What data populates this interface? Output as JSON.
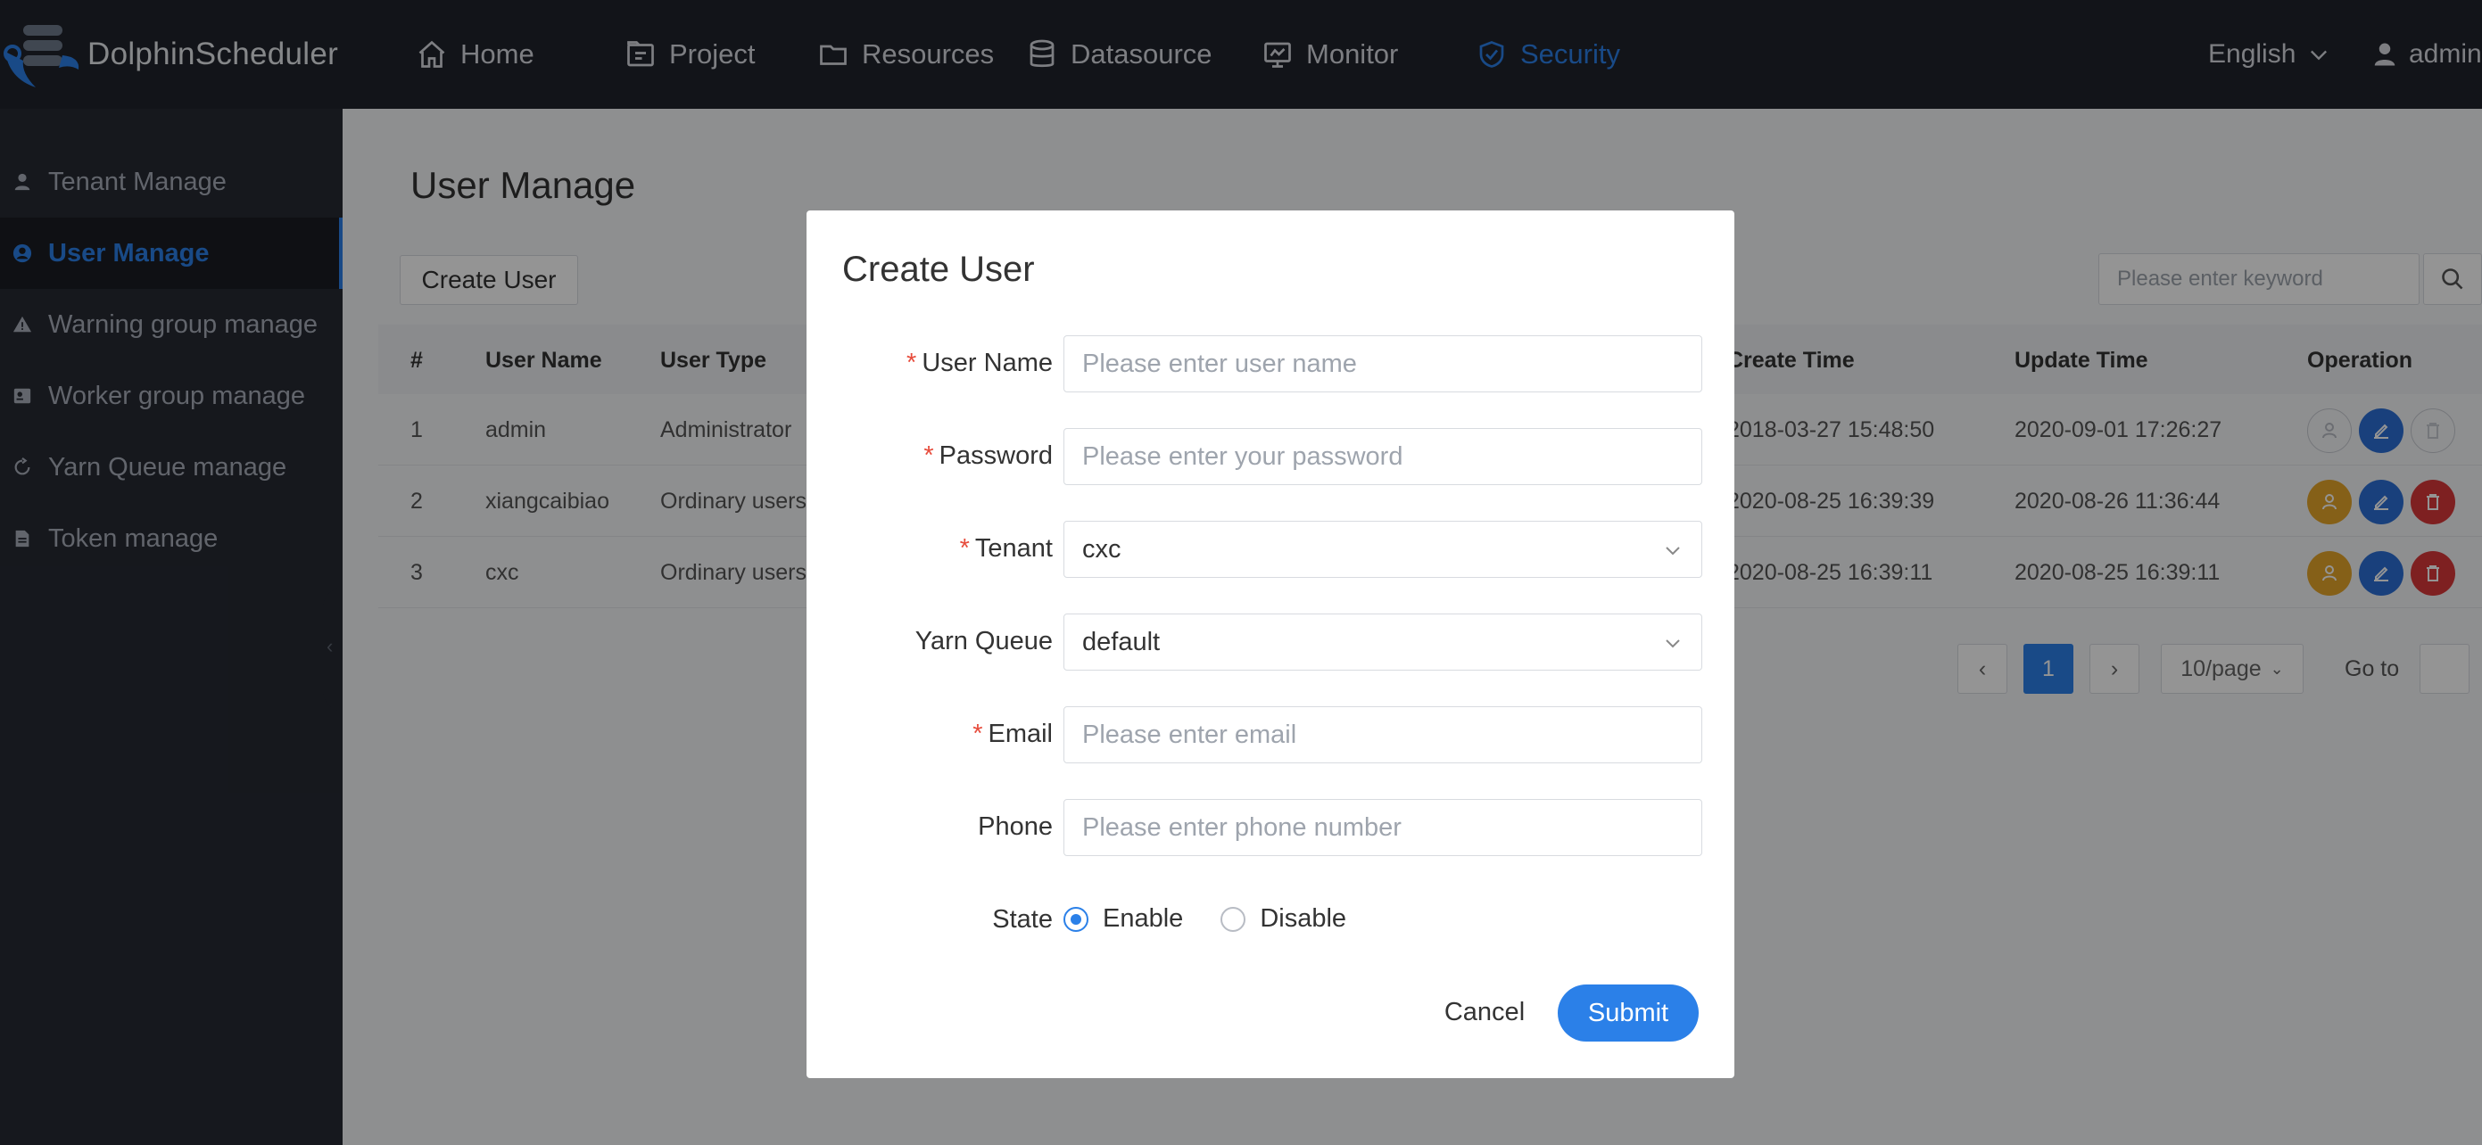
{
  "app": {
    "title": "DolphinScheduler"
  },
  "nav": {
    "items": [
      {
        "label": "Home",
        "icon": "home-icon"
      },
      {
        "label": "Project",
        "icon": "project-icon"
      },
      {
        "label": "Resources",
        "icon": "folder-icon"
      },
      {
        "label": "Datasource",
        "icon": "database-icon"
      },
      {
        "label": "Monitor",
        "icon": "monitor-icon"
      },
      {
        "label": "Security",
        "icon": "shield-icon",
        "active": true
      }
    ],
    "language": "English",
    "user": "admin"
  },
  "sidebar": {
    "items": [
      {
        "label": "Tenant Manage",
        "icon": "user-icon"
      },
      {
        "label": "User Manage",
        "icon": "user-circle-icon",
        "active": true
      },
      {
        "label": "Warning group manage",
        "icon": "warning-icon"
      },
      {
        "label": "Worker group manage",
        "icon": "id-card-icon"
      },
      {
        "label": "Yarn Queue manage",
        "icon": "recycle-icon"
      },
      {
        "label": "Token manage",
        "icon": "document-icon"
      }
    ]
  },
  "main": {
    "title": "User Manage",
    "create_button": "Create User",
    "search_placeholder": "Please enter keyword",
    "columns": [
      "#",
      "User Name",
      "User Type",
      "Create Time",
      "Update Time",
      "Operation"
    ],
    "rows": [
      {
        "index": "1",
        "name": "admin",
        "type": "Administrator",
        "create_time": "2018-03-27 15:48:50",
        "update_time": "2020-09-01 17:26:27"
      },
      {
        "index": "2",
        "name": "xiangcaibiao",
        "type": "Ordinary users",
        "create_time": "2020-08-25 16:39:39",
        "update_time": "2020-08-26 11:36:44"
      },
      {
        "index": "3",
        "name": "cxc",
        "type": "Ordinary users",
        "create_time": "2020-08-25 16:39:11",
        "update_time": "2020-08-25 16:39:11"
      }
    ],
    "pagination": {
      "current_page": "1",
      "page_size": "10/page",
      "goto_label": "Go to"
    }
  },
  "modal": {
    "title": "Create User",
    "fields": {
      "user_name": {
        "label": "User Name",
        "placeholder": "Please enter user name",
        "required": true
      },
      "password": {
        "label": "Password",
        "placeholder": "Please enter your password",
        "required": true
      },
      "tenant": {
        "label": "Tenant",
        "value": "cxc",
        "required": true
      },
      "yarn_queue": {
        "label": "Yarn Queue",
        "value": "default"
      },
      "email": {
        "label": "Email",
        "placeholder": "Please enter email",
        "required": true
      },
      "phone": {
        "label": "Phone",
        "placeholder": "Please enter phone number"
      },
      "state": {
        "label": "State",
        "options": [
          "Enable",
          "Disable"
        ],
        "selected": "Enable"
      }
    },
    "cancel": "Cancel",
    "submit": "Submit"
  },
  "colors": {
    "accent": "#2b80e8",
    "topbar": "#1f232b",
    "sidebar": "#262a33",
    "required": "#e74c3c",
    "op_orange": "#e6a52a",
    "op_blue": "#2b6fd6",
    "op_red": "#d9383a"
  }
}
